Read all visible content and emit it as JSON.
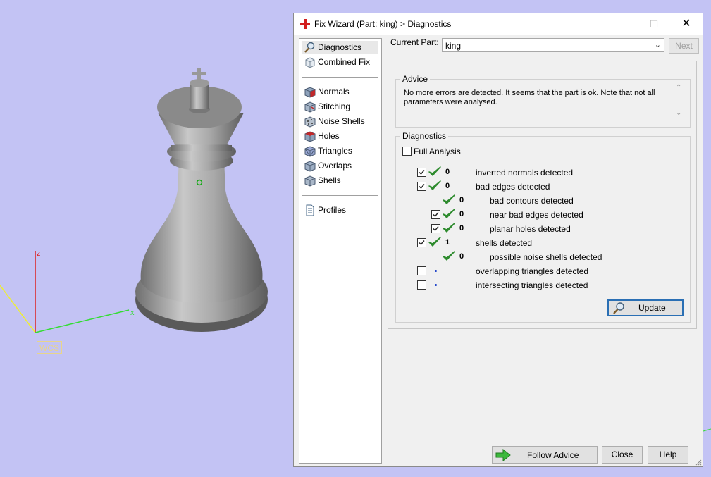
{
  "viewport": {
    "background": "#c3c3f4",
    "wcs_label": "WCS",
    "axes": {
      "x": "x",
      "z": "z",
      "x_color": "#33dd33",
      "z_color": "#dd2222",
      "y_color": "#eeee33"
    }
  },
  "window": {
    "title": "Fix Wizard (Part: king) > Diagnostics",
    "icon": "red-cross-icon",
    "controls": {
      "minimize": "—",
      "maximize": "☐",
      "close": "✕"
    }
  },
  "nav": {
    "items_top": [
      {
        "label": "Diagnostics",
        "icon": "magnifier-icon",
        "selected": true
      },
      {
        "label": "Combined Fix",
        "icon": "cube-outline-icon"
      }
    ],
    "items_mid": [
      {
        "label": "Normals",
        "icon": "normals-cube-icon"
      },
      {
        "label": "Stitching",
        "icon": "stitching-cube-icon"
      },
      {
        "label": "Noise Shells",
        "icon": "noise-shells-icon"
      },
      {
        "label": "Holes",
        "icon": "holes-cube-icon"
      },
      {
        "label": "Triangles",
        "icon": "triangles-cube-icon"
      },
      {
        "label": "Overlaps",
        "icon": "overlaps-cube-icon"
      },
      {
        "label": "Shells",
        "icon": "shells-cube-icon"
      }
    ],
    "items_bottom": [
      {
        "label": "Profiles",
        "icon": "document-icon"
      }
    ]
  },
  "header": {
    "current_part_label": "Current Part:",
    "current_part_value": "king",
    "next_label": "Next"
  },
  "advice": {
    "title": "Advice",
    "text": "No more errors are detected. It seems that the part is ok. Note that not all parameters were analysed."
  },
  "diagnostics": {
    "title": "Diagnostics",
    "full_analysis_label": "Full Analysis",
    "full_analysis_checked": false,
    "rows": [
      {
        "label": "inverted normals detected",
        "value": "0",
        "checkbox": true,
        "checked": true,
        "status": "ok",
        "indent": 0
      },
      {
        "label": "bad edges detected",
        "value": "0",
        "checkbox": true,
        "checked": true,
        "status": "ok",
        "indent": 0
      },
      {
        "label": "bad contours detected",
        "value": "0",
        "checkbox": false,
        "status": "ok",
        "indent": 1
      },
      {
        "label": "near bad edges detected",
        "value": "0",
        "checkbox": true,
        "checked": true,
        "status": "ok",
        "indent": 1
      },
      {
        "label": "planar holes detected",
        "value": "0",
        "checkbox": true,
        "checked": true,
        "status": "ok",
        "indent": 1
      },
      {
        "label": "shells detected",
        "value": "1",
        "checkbox": true,
        "checked": true,
        "status": "ok",
        "indent": 0
      },
      {
        "label": "possible noise shells detected",
        "value": "0",
        "checkbox": false,
        "status": "ok",
        "indent": 1
      },
      {
        "label": "overlapping triangles detected",
        "value": "",
        "checkbox": true,
        "checked": false,
        "status": "pending",
        "indent": 0
      },
      {
        "label": "intersecting triangles detected",
        "value": "",
        "checkbox": true,
        "checked": false,
        "status": "pending",
        "indent": 0
      }
    ],
    "update_label": "Update"
  },
  "footer": {
    "follow_advice_label": "Follow Advice",
    "close_label": "Close",
    "help_label": "Help"
  },
  "colors": {
    "check_green": "#2e8b2e",
    "accent_blue": "#1a3fc8",
    "window_bg": "#f0f0f0"
  }
}
